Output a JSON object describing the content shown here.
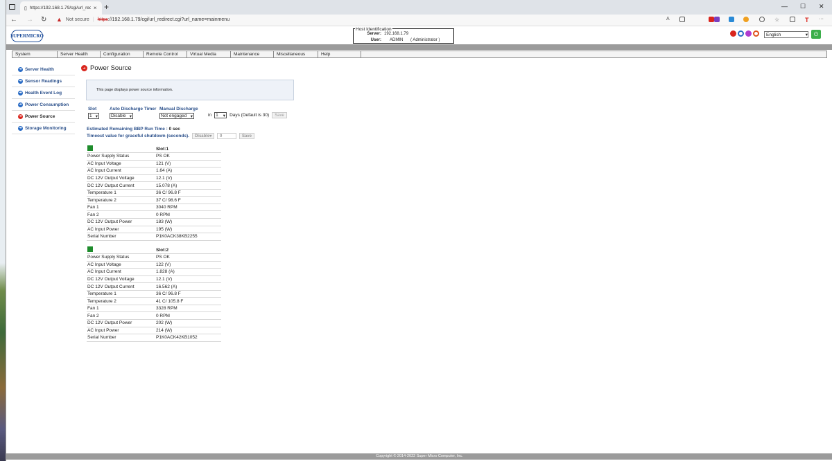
{
  "browser": {
    "tab_title": "https://192.168.1.79/cgi/url_redi",
    "tab_close": "×",
    "new_tab": "+",
    "not_secure": "Not secure",
    "url_scheme": "https",
    "url_rest": "://192.168.1.79/cgi/url_redirect.cgi?url_name=mainmenu"
  },
  "header": {
    "logo_text": "SUPERMICRO",
    "host_legend": "Host Identification",
    "server_label": "Server:",
    "server_value": "192.168.1.79",
    "user_label": "User:",
    "user_value": "ADMIN",
    "user_role": "( Administrator )",
    "language": "English"
  },
  "menu": [
    "System",
    "Server Health",
    "Configuration",
    "Remote Control",
    "Virtual Media",
    "Maintenance",
    "Miscellaneous",
    "Help"
  ],
  "sidebar": [
    {
      "label": "Server Health",
      "active": false
    },
    {
      "label": "Sensor Readings",
      "active": false
    },
    {
      "label": "Health Event Log",
      "active": false
    },
    {
      "label": "Power Consumption",
      "active": false
    },
    {
      "label": "Power Source",
      "active": true
    },
    {
      "label": "Storage Monitoring",
      "active": false
    }
  ],
  "main": {
    "title": "Power Source",
    "info": "This page displays power source information.",
    "slot_label": "Slot",
    "slot_value": "1",
    "timer_label": "Auto Discharge Timer",
    "timer_value": "Disable",
    "manual_label": "Manual Discharge",
    "manual_value": "Not engaged",
    "in_label": "in",
    "days_value": "1",
    "days_label": "Days (Default is 30)",
    "save_label": "Save",
    "bbp_label": "Estimated Remaining BBP Run Time :",
    "bbp_value": "0 sec",
    "timeout_label": "Timeout value for graceful shutdown (seconds).",
    "timeout_sel": "Disable",
    "timeout_value": "0",
    "save2_label": "Save"
  },
  "slots": [
    {
      "header": "Slot:1",
      "rows": [
        [
          "Power Supply Status",
          "PS OK"
        ],
        [
          "AC Input Voltage",
          "121 (V)"
        ],
        [
          "AC Input Current",
          "1.64 (A)"
        ],
        [
          "DC 12V Output Voltage",
          "12.1 (V)"
        ],
        [
          "DC 12V Output Current",
          "15.078 (A)"
        ],
        [
          "Temperature 1",
          "36 C/ 96.8 F"
        ],
        [
          "Temperature 2",
          "37 C/ 98.6 F"
        ],
        [
          "Fan 1",
          "3040 RPM"
        ],
        [
          "Fan 2",
          "0 RPM"
        ],
        [
          "DC 12V Output Power",
          "183 (W)"
        ],
        [
          "AC Input Power",
          "195 (W)"
        ],
        [
          "Serial Number",
          "P1K0ACK38KB2255"
        ]
      ]
    },
    {
      "header": "Slot:2",
      "rows": [
        [
          "Power Supply Status",
          "PS OK"
        ],
        [
          "AC Input Voltage",
          "122 (V)"
        ],
        [
          "AC Input Current",
          "1.828 (A)"
        ],
        [
          "DC 12V Output Voltage",
          "12.1 (V)"
        ],
        [
          "DC 12V Output Current",
          "16.562 (A)"
        ],
        [
          "Temperature 1",
          "36 C/ 96.8 F"
        ],
        [
          "Temperature 2",
          "41 C/ 105.8 F"
        ],
        [
          "Fan 1",
          "3328 RPM"
        ],
        [
          "Fan 2",
          "0 RPM"
        ],
        [
          "DC 12V Output Power",
          "202 (W)"
        ],
        [
          "AC Input Power",
          "214 (W)"
        ],
        [
          "Serial Number",
          "P1K0ACK42KB1052"
        ]
      ]
    }
  ],
  "footer": "Copyright © 2014-2022 Super Micro Computer, Inc."
}
